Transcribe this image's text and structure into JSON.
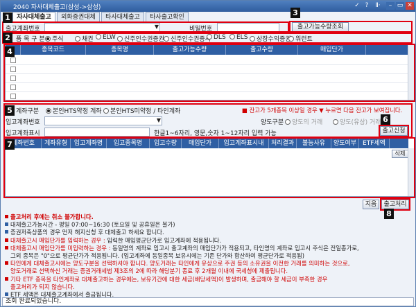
{
  "window": {
    "title": "2040 자사대체출고(삼성->삼성)",
    "controls": [
      "✓",
      "?",
      "Ⅱ·",
      "–",
      "▭",
      "✕"
    ]
  },
  "badges": [
    "1",
    "2",
    "3",
    "4",
    "5",
    "6",
    "7",
    "8"
  ],
  "tabs": [
    "자사대체출고",
    "외화증권대체",
    "타사대체출고",
    "타사출고확인"
  ],
  "account": {
    "label": "출고계좌번호",
    "password_label": "비밀번호",
    "query_button": "출고가능수량조회"
  },
  "product": {
    "label": "품 목 구 분",
    "options": [
      "주식",
      "채권",
      "ELW",
      "신주인수권증권",
      "신주인수권증서",
      "DLS",
      "ELS",
      "상장수익증권",
      "워런트"
    ],
    "selected": 0
  },
  "grid1": {
    "columns": [
      "종목코드",
      "종목명",
      "출고가능수량",
      "출고수량",
      "매입단가"
    ],
    "rows": 5
  },
  "form": {
    "account_type_label": "계좌구분",
    "account_type_options": [
      "본인HTS약정 계좌",
      "본인HTS미약정 / 타인계좌"
    ],
    "notice": "■ 잔고가 5개종목 이상일 경우 ▼ 누르면 다음 잔고가 보여집니다.",
    "deposit_label": "입고계좌번호",
    "transfer_label": "양도구분",
    "transfer_options": [
      "양도의 거래",
      "양도(유상) 거래"
    ],
    "display_label": "입고계좌표시",
    "display_hint": "한글1~6자리, 영문,숫자 1~12자리 입력 가능",
    "request_button": "출고신청"
  },
  "grid2": {
    "columns": [
      "계좌번호",
      "계좌유형",
      "입고계좌명",
      "입고종목명",
      "입고수량",
      "매입단가",
      "입고계좌표시내",
      "처리결과",
      "불능사유",
      "양도여부",
      "ETF세액"
    ],
    "delete_button": "삭제"
  },
  "actions": {
    "reset": "지움",
    "process": "출고처리"
  },
  "notes": [
    {
      "text": "출고처리 후에는 취소 불가합니다.",
      "style": "title"
    },
    {
      "text": "대체출고가능시간 - 평일 07:00~16:30 (토요일 및 공휴일은 불가)",
      "style": "normal"
    },
    {
      "text": "증권저축상품의 경우 먼저 해지신청 후 대체출고 하세요 합니다.",
      "style": "normal"
    },
    {
      "text": "대체출고시 매입단가를 입력하는 경우 : 입력한 매입평균단가로 입고계좌에 적용됩니다.",
      "style": "red-lead",
      "lead": "대체출고시 매입단가를 입력하는 경우 :",
      "rest": " 입력한 매입평균단가로 입고계좌에 적용됩니다."
    },
    {
      "text": "대체출고시 매입단가를 미입력하는 경우 : 동일명의 계좌로 입고시 출고계좌의 매입단가가 적용되고, 타인명의 계좌로 입고시 주식은 전일종가로,",
      "style": "red-lead",
      "lead": "대체출고시 매입단가를 미입력하는 경우 :",
      "rest": " 동일명의 계좌로 입고시 출고계좌의 매입단가가 적용되고, 타인명의 계좌로 입고시 주식은 전일종가로,"
    },
    {
      "text": "그외 종목은 \"0\"으로 평균단가가 적용됩니다. (입고계좌에 동일종목 보유시에는 기존 단가와 합산하여 평균단가로 적용됨)",
      "style": "indent"
    },
    {
      "text": "타인에게 대체출고시에는 양도구분을 선택하셔야 합니다. 양도거래는 타인에게 유상으로 주권 등의 소유권을 이전한 거래를 의미하는 것으로,",
      "style": "red"
    },
    {
      "text": "양도거래로 선택하신 거래는 증권거래세법 제3조의 2에 따라 해당분기 종료 후 2개월 이내에 국세청에 제출됩니다.",
      "style": "red-indent"
    },
    {
      "text": "기타 ETF 종목을 타인계좌로 대체출고하는 경우에는, 보유기간에 대한 세금(배당세액)이 발생하며, 출금해야 할 세금이 부족한 경우",
      "style": "red"
    },
    {
      "text": "출고처리가 되지 않습니다.",
      "style": "red-indent"
    },
    {
      "text": "ETF 세액은 대체출고계좌에서 출금됩니다.",
      "style": "normal"
    }
  ],
  "status": "조회 완료되었습니다.",
  "colors": {
    "accent": "#2f5fa3",
    "highlight": "#e00010",
    "badge": "#111111"
  }
}
